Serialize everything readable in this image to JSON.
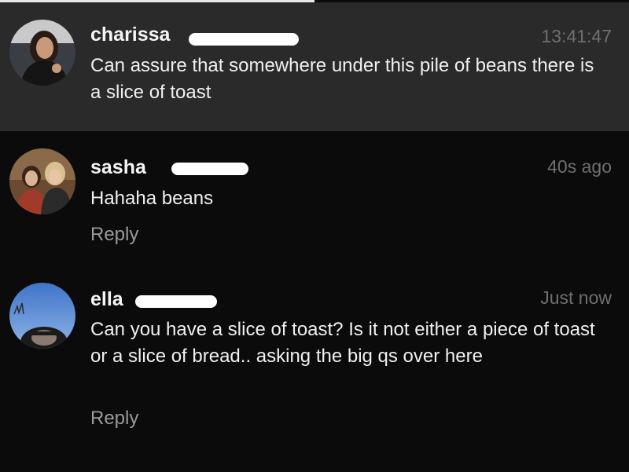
{
  "comments": [
    {
      "username": "charissa",
      "time": "13:41:47",
      "text": "Can assure that somewhere under this pile of beans there is a slice of toast",
      "avatar_icon": "profile-photo"
    },
    {
      "username": "sasha",
      "time": "40s ago",
      "text": "Hahaha beans",
      "reply_label": "Reply",
      "avatar_icon": "profile-photo"
    },
    {
      "username": "ella",
      "time": "Just now",
      "text": "Can you have a slice of toast? Is it not either a piece of toast or a slice of bread.. asking the big qs over here",
      "reply_label": "Reply",
      "avatar_icon": "profile-photo"
    }
  ],
  "colors": {
    "background": "#0b0b0b",
    "highlight_row": "#2a2a2a",
    "timestamp": "#6f6f6f",
    "reply": "#9a9a9a"
  }
}
